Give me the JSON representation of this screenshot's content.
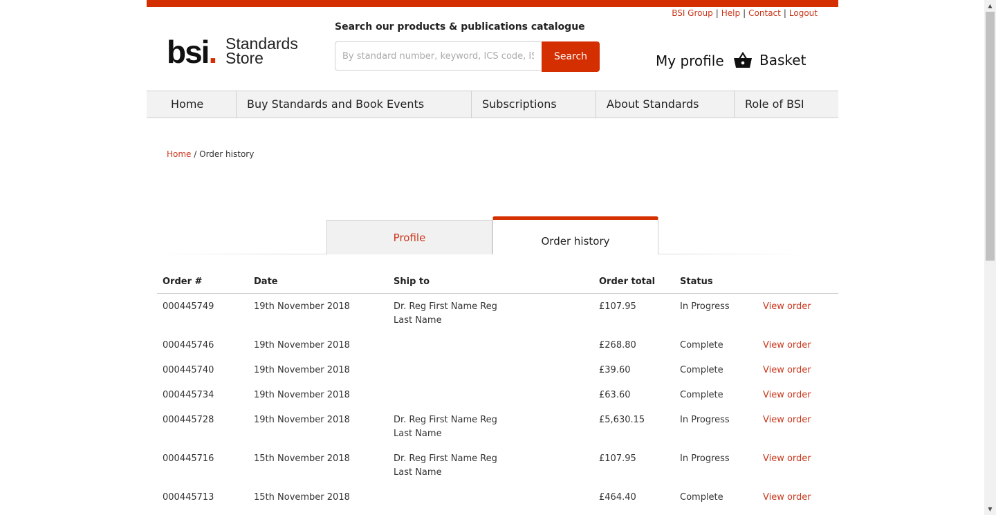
{
  "top_links": [
    "BSI Group",
    "Help",
    "Contact",
    "Logout"
  ],
  "logo": {
    "brand": "bsi",
    "dot": ".",
    "line1": "Standards",
    "line2": "Store"
  },
  "search": {
    "label": "Search our products & publications catalogue",
    "placeholder": "By standard number, keyword, ICS code, ISBN",
    "button": "Search"
  },
  "header": {
    "profile": "My profile",
    "basket": "Basket"
  },
  "nav": [
    "Home",
    "Buy Standards and Book Events",
    "Subscriptions",
    "About Standards",
    "Role of BSI"
  ],
  "breadcrumb": {
    "home": "Home",
    "separator": "/",
    "current": "Order history"
  },
  "tabs": {
    "profile": "Profile",
    "orders": "Order history"
  },
  "table": {
    "columns": [
      "Order #",
      "Date",
      "Ship to",
      "Order total",
      "Status",
      ""
    ],
    "view_label": "View order",
    "rows": [
      {
        "order": "000445749",
        "date": "19th November 2018",
        "ship_to": "Dr. Reg First Name Reg Last Name",
        "total": "£107.95",
        "status": "In Progress"
      },
      {
        "order": "000445746",
        "date": "19th November 2018",
        "ship_to": "",
        "total": "£268.80",
        "status": "Complete"
      },
      {
        "order": "000445740",
        "date": "19th November 2018",
        "ship_to": "",
        "total": "£39.60",
        "status": "Complete"
      },
      {
        "order": "000445734",
        "date": "19th November 2018",
        "ship_to": "",
        "total": "£63.60",
        "status": "Complete"
      },
      {
        "order": "000445728",
        "date": "19th November 2018",
        "ship_to": "Dr. Reg First Name Reg Last Name",
        "total": "£5,630.15",
        "status": "In Progress"
      },
      {
        "order": "000445716",
        "date": "15th November 2018",
        "ship_to": "Dr. Reg First Name Reg Last Name",
        "total": "£107.95",
        "status": "In Progress"
      },
      {
        "order": "000445713",
        "date": "15th November 2018",
        "ship_to": "",
        "total": "£464.40",
        "status": "Complete"
      }
    ]
  },
  "colors": {
    "accent": "#d32f00",
    "link": "#c8361a",
    "nav_bg": "#f2f2f2"
  },
  "icons": {
    "basket": "basket-icon"
  }
}
